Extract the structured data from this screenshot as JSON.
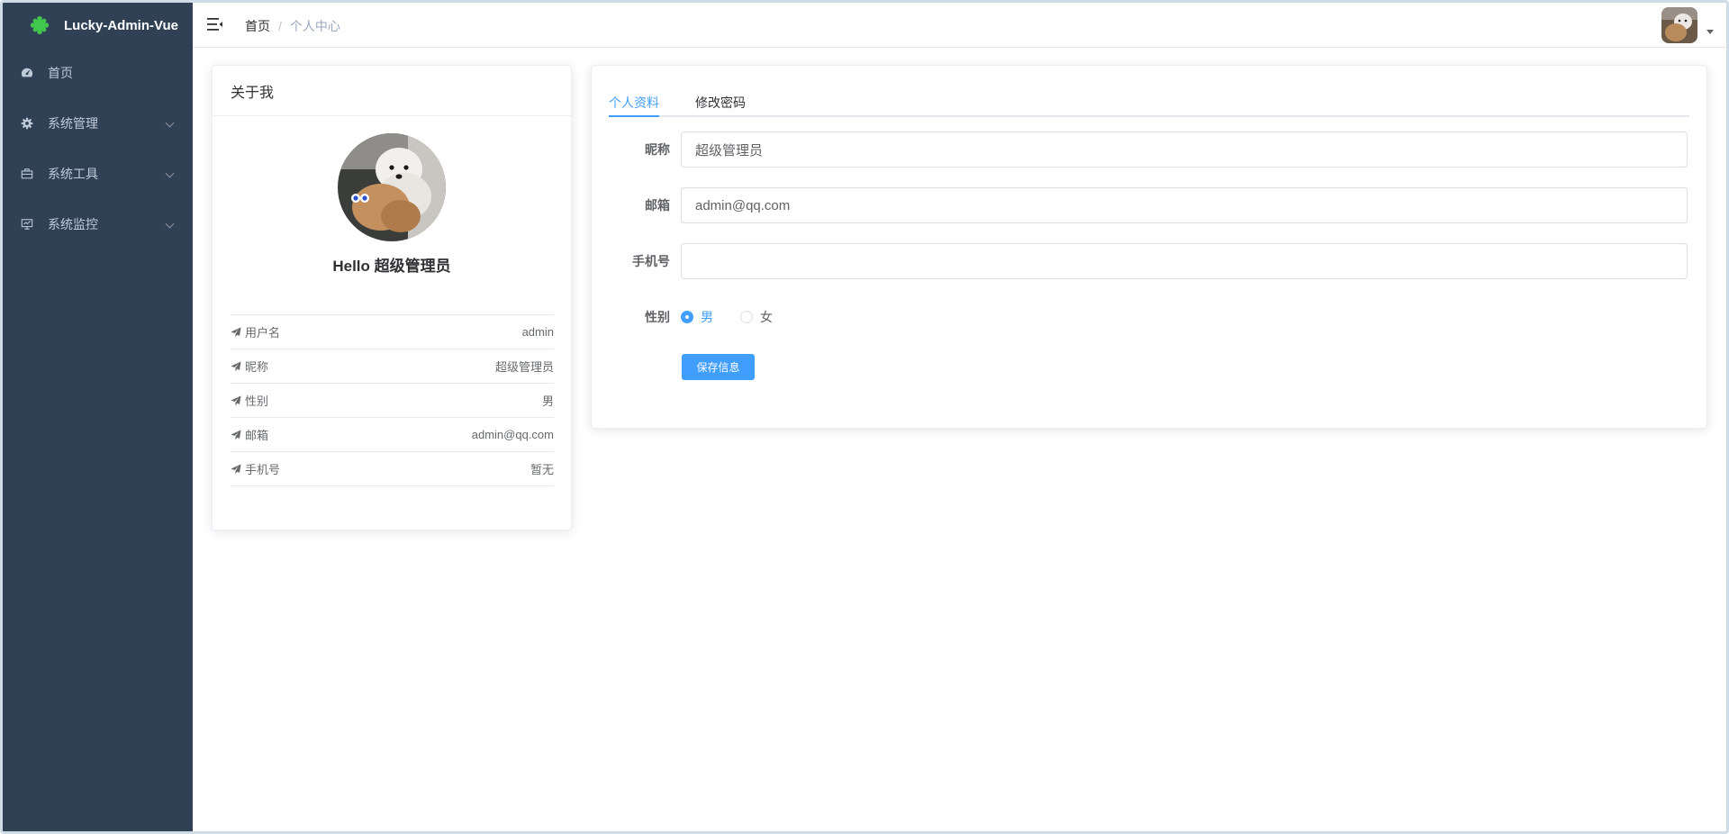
{
  "app": {
    "title": "Lucky-Admin-Vue"
  },
  "sidebar": {
    "items": [
      {
        "label": "首页",
        "icon": "dashboard-icon",
        "has_submenu": false
      },
      {
        "label": "系统管理",
        "icon": "gear-icon",
        "has_submenu": true
      },
      {
        "label": "系统工具",
        "icon": "toolbox-icon",
        "has_submenu": true
      },
      {
        "label": "系统监控",
        "icon": "monitor-icon",
        "has_submenu": true
      }
    ]
  },
  "header": {
    "breadcrumb": {
      "home": "首页",
      "separator": "/",
      "current": "个人中心"
    }
  },
  "profile_card": {
    "title": "关于我",
    "greeting": "Hello 超级管理员",
    "rows": [
      {
        "label": "用户名",
        "value": "admin"
      },
      {
        "label": "昵称",
        "value": "超级管理员"
      },
      {
        "label": "性别",
        "value": "男"
      },
      {
        "label": "邮箱",
        "value": "admin@qq.com"
      },
      {
        "label": "手机号",
        "value": "暂无"
      }
    ]
  },
  "edit_card": {
    "tabs": [
      {
        "label": "个人资料",
        "active": true
      },
      {
        "label": "修改密码",
        "active": false
      }
    ],
    "form": {
      "nickname_label": "昵称",
      "nickname_value": "超级管理员",
      "email_label": "邮箱",
      "email_value": "admin@qq.com",
      "phone_label": "手机号",
      "phone_value": "",
      "gender_label": "性别",
      "gender_options": [
        {
          "label": "男",
          "checked": true
        },
        {
          "label": "女",
          "checked": false
        }
      ],
      "save_label": "保存信息"
    }
  },
  "colors": {
    "sidebar_bg": "#304156",
    "accent": "#409eff",
    "logo_green": "#41c94e"
  }
}
